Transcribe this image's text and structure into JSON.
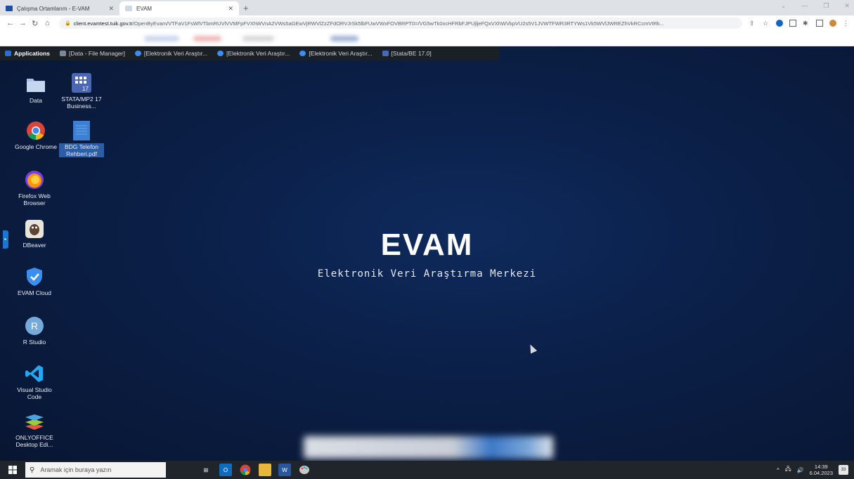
{
  "browser": {
    "tabs": [
      {
        "title": "Çalışma Ortamlarım - E-VAM",
        "active": false
      },
      {
        "title": "EVAM",
        "active": true
      }
    ],
    "new_tab": "+",
    "url_host": "client.evamtest.tuik.gov.tr",
    "url_path": "/OpenByEvam/VTFaV1FsWlVTbmRUVlVVMFpFVXhWVnA2VWs5aGEwVjRWVlZzZFdORVJrSk5lbFUwVWxFOVBRPT0=/VG5wTk0xcHFRbFJPUjljeFQxVXhWVkpVU2s5V1JVWTFWR3RTYWs1Vk5WVlJWREZhVkRCcmVtRk..."
  },
  "xfce_panel": {
    "app_menu": "Applications",
    "tasks": [
      "[Data - File Manager]",
      "[Elektronik Veri Araştır...",
      "[Elektronik Veri Araştır...",
      "[Elektronik Veri Araştır...",
      "[Stata/BE 17.0]"
    ]
  },
  "desktop_icons": [
    {
      "label": "Data",
      "icon": "folder-icon"
    },
    {
      "label": "STATA/MP2 17 Business...",
      "icon": "stata-icon"
    },
    {
      "label": "Google Chrome",
      "icon": "chrome-icon"
    },
    {
      "label": "BDG Telefon Rehberi.pdf",
      "icon": "document-icon"
    },
    {
      "label": "Firefox Web Browser",
      "icon": "firefox-icon"
    },
    {
      "label": "DBeaver",
      "icon": "dbeaver-icon"
    },
    {
      "label": "EVAM Cloud",
      "icon": "shield-icon"
    },
    {
      "label": "R Studio",
      "icon": "r-icon"
    },
    {
      "label": "Visual Studio Code",
      "icon": "vscode-icon"
    },
    {
      "label": "ONLYOFFICE Desktop Edi...",
      "icon": "onlyoffice-icon"
    }
  ],
  "brand": {
    "title": "EVAM",
    "subtitle": "Elektronik Veri Araştırma Merkezi"
  },
  "taskbar": {
    "search_placeholder": "Aramak için buraya yazın",
    "time": "14:39",
    "date": "6.04.2023",
    "notifications": "33"
  },
  "colors": {
    "desktop_bg": "#0b1f47",
    "taskbar_bg": "#20242b",
    "accent": "#1976d2"
  }
}
